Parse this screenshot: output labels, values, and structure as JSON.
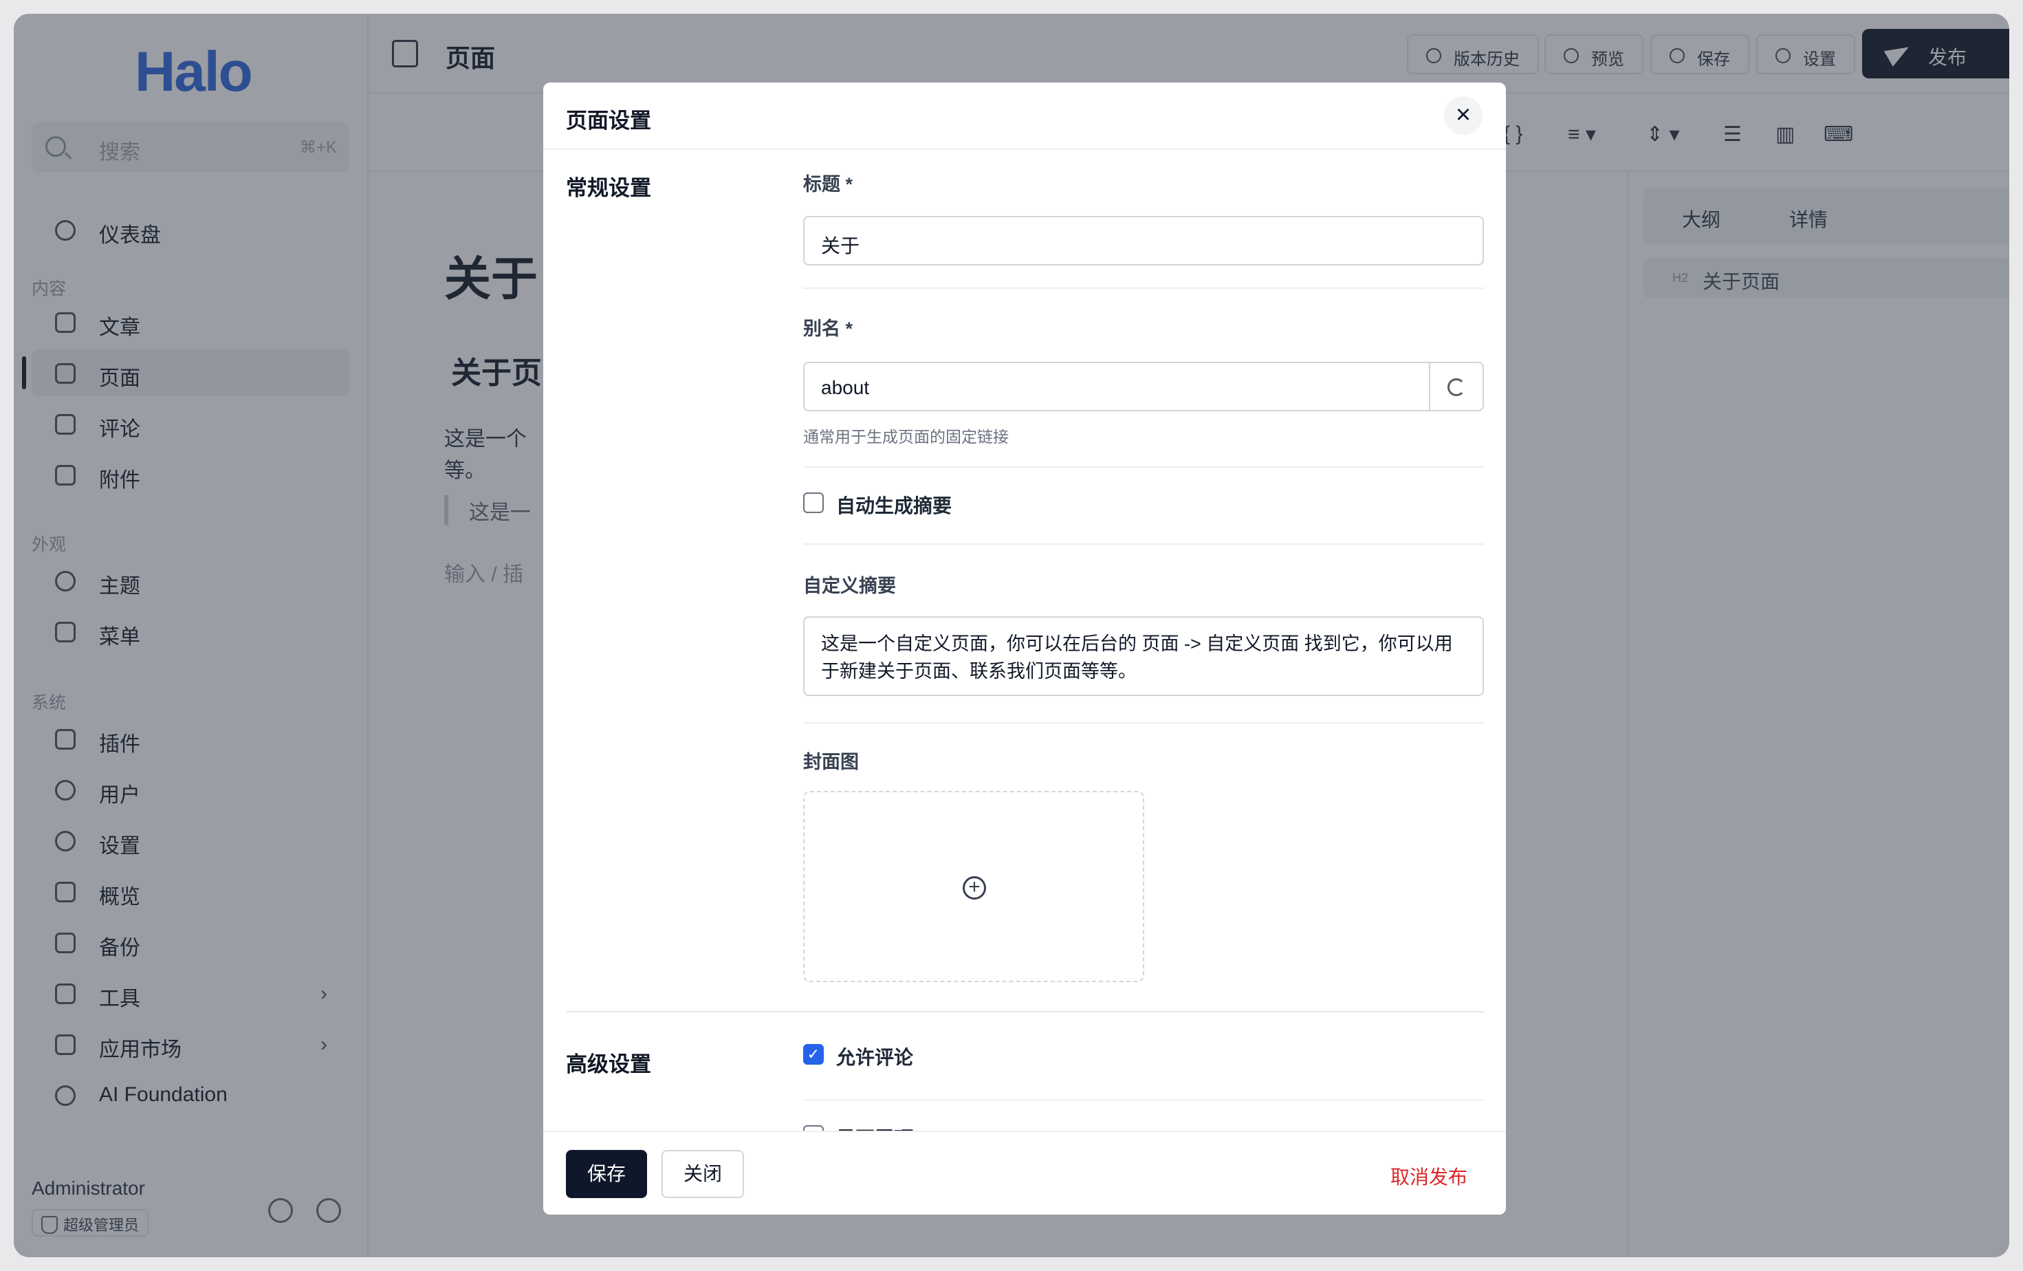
{
  "sidebar": {
    "logo": "Halo",
    "search_placeholder": "搜索",
    "search_shortcut": "⌘+K",
    "dashboard": "仪表盘",
    "group_content": "内容",
    "posts": "文章",
    "pages": "页面",
    "comments": "评论",
    "attachments": "附件",
    "group_appearance": "外观",
    "themes": "主题",
    "menus": "菜单",
    "group_system": "系统",
    "plugins": "插件",
    "users": "用户",
    "settings": "设置",
    "overview": "概览",
    "backup": "备份",
    "tools": "工具",
    "app_market": "应用市场",
    "ai_foundation": "AI Foundation",
    "user_name": "Administrator",
    "user_role": "超级管理员"
  },
  "topbar": {
    "title": "页面",
    "history": "版本历史",
    "preview": "预览",
    "save": "保存",
    "settings": "设置",
    "publish": "发布"
  },
  "editor": {
    "title": "关于",
    "heading": "关于页",
    "para_line1": "这是一个",
    "para_line2": "等。",
    "quote": "这是一",
    "hint": "输入 / 插"
  },
  "right_panel": {
    "tab_outline": "大纲",
    "tab_detail": "详情",
    "outline_tag": "H2",
    "outline_item": "关于页面"
  },
  "modal": {
    "title": "页面设置",
    "close_icon": "×",
    "section_general": "常规设置",
    "title_label": "标题 *",
    "title_value": "关于",
    "slug_label": "别名 *",
    "slug_value": "about",
    "slug_help": "通常用于生成页面的固定链接",
    "auto_excerpt_label": "自动生成摘要",
    "auto_excerpt_checked": false,
    "custom_excerpt_label": "自定义摘要",
    "custom_excerpt_value": "这是一个自定义页面，你可以在后台的 页面 -> 自定义页面 找到它，你可以用于新建关于页面、联系我们页面等等。",
    "cover_label": "封面图",
    "section_advanced": "高级设置",
    "allow_comment_label": "允许评论",
    "allow_comment_checked": true,
    "pinned_label": "是否置顶",
    "save_button": "保存",
    "close_button": "关闭",
    "unpublish_button": "取消发布"
  }
}
